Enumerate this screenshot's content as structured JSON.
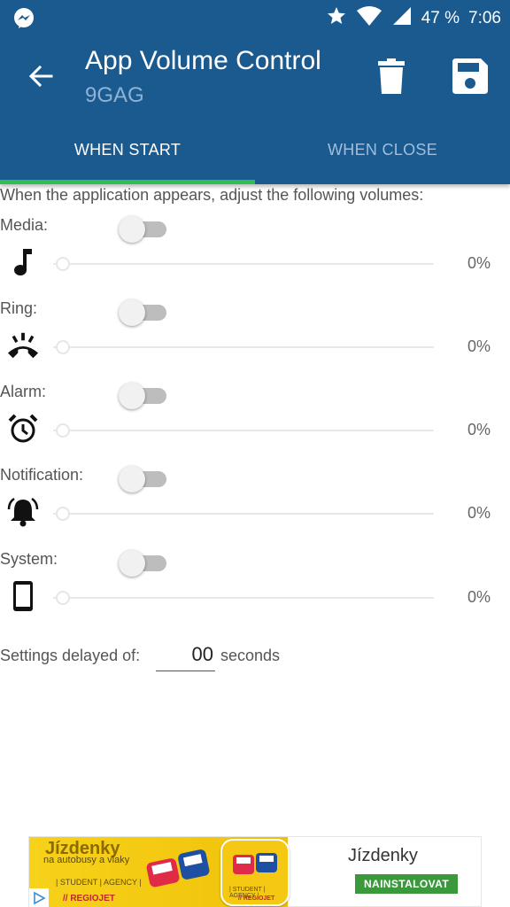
{
  "status_bar": {
    "battery": "47 %",
    "time": "7:06"
  },
  "app_bar": {
    "title": "App Volume Control",
    "subtitle": "9GAG",
    "back_icon": "arrow-left-icon",
    "delete_icon": "trash-icon",
    "save_icon": "floppy-disk-icon"
  },
  "tabs": [
    {
      "label": "WHEN START",
      "selected": true
    },
    {
      "label": "WHEN CLOSE",
      "selected": false
    }
  ],
  "intro": "When the application appears, adjust the following volumes:",
  "volumes": [
    {
      "label": "Media:",
      "icon": "music-note-icon",
      "enabled": false,
      "value": "0%"
    },
    {
      "label": "Ring:",
      "icon": "phone-ringing-icon",
      "enabled": false,
      "value": "0%"
    },
    {
      "label": "Alarm:",
      "icon": "alarm-clock-icon",
      "enabled": false,
      "value": "0%"
    },
    {
      "label": "Notification:",
      "icon": "bell-ringing-icon",
      "enabled": false,
      "value": "0%"
    },
    {
      "label": "System:",
      "icon": "smartphone-icon",
      "enabled": false,
      "value": "0%"
    }
  ],
  "delay": {
    "label": "Settings delayed of:",
    "value": "00",
    "unit": "seconds"
  },
  "ad": {
    "headline": "Jízdenky",
    "subline": "na autobusy a vlaky",
    "agency": "| STUDENT | AGENCY |",
    "brand": "// REGIOJET",
    "app_name": "Jízdenky",
    "cta": "NAINSTALOVAT"
  },
  "colors": {
    "primary": "#1b5a8f",
    "indicator": "#2dbf4f",
    "cta": "#3a9a3b"
  }
}
